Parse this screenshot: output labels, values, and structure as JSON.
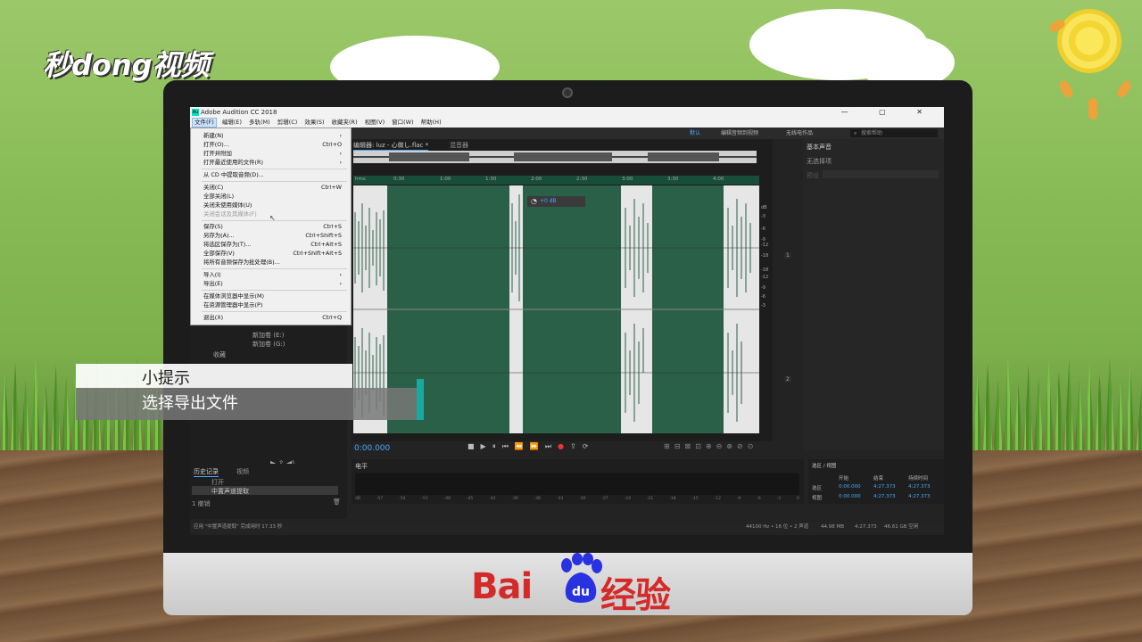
{
  "watermark_top": "秒dong视频",
  "app": {
    "title": "Adobe Audition CC 2018",
    "menu": [
      "文件(F)",
      "编辑(E)",
      "多轨(M)",
      "剪辑(C)",
      "效果(S)",
      "收藏夹(R)",
      "视图(V)",
      "窗口(W)",
      "帮助(H)"
    ],
    "workspace": {
      "default": "默认",
      "edit_video": "编辑音频到视频",
      "wireless": "无线电作品",
      "search_placeholder": "搜索帮助"
    },
    "file_menu": [
      {
        "label": "新建(N)",
        "shortcut": "",
        "sub": true
      },
      {
        "label": "打开(O)...",
        "shortcut": "Ctrl+O"
      },
      {
        "label": "打开并附加",
        "shortcut": "",
        "sub": true
      },
      {
        "label": "打开最近使用的文件(R)",
        "shortcut": "",
        "sub": true
      },
      {
        "label": "从 CD 中提取音频(D)...",
        "shortcut": ""
      },
      {
        "label": "关闭(C)",
        "shortcut": "Ctrl+W"
      },
      {
        "label": "全部关闭(L)",
        "shortcut": ""
      },
      {
        "label": "关闭未使用媒体(U)",
        "shortcut": ""
      },
      {
        "label": "关闭会话及其媒体(F)",
        "shortcut": "",
        "disabled": true
      },
      {
        "label": "保存(S)",
        "shortcut": "Ctrl+S"
      },
      {
        "label": "另存为(A)...",
        "shortcut": "Ctrl+Shift+S"
      },
      {
        "label": "将选区保存为(T)...",
        "shortcut": "Ctrl+Alt+S"
      },
      {
        "label": "全部保存(V)",
        "shortcut": "Ctrl+Shift+Alt+S"
      },
      {
        "label": "将所有音频保存为批处理(B)...",
        "shortcut": ""
      },
      {
        "label": "导入(I)",
        "shortcut": "",
        "sub": true
      },
      {
        "label": "导出(E)",
        "shortcut": "",
        "sub": true
      },
      {
        "label": "在媒体浏览器中显示(M)",
        "shortcut": ""
      },
      {
        "label": "在资源管理器中显示(P)",
        "shortcut": ""
      },
      {
        "label": "退出(X)",
        "shortcut": "Ctrl+Q"
      }
    ],
    "editor_tab": "编辑器: luz - 心做し.flac *",
    "mixer_tab": "混音器",
    "ruler_ticks": [
      "hms",
      "0:30",
      "1:00",
      "1:30",
      "2:00",
      "2:30",
      "3:00",
      "3:30",
      "4:00"
    ],
    "db_labels": [
      "dB",
      "-3",
      "-6",
      "-9",
      "-12",
      "-18",
      "-18",
      "-12",
      "-9",
      "-6",
      "-3"
    ],
    "channel_labels": [
      "1",
      "2"
    ],
    "timecode": "0:00.000",
    "volume_overlay": "+0 dB",
    "essential_sound": {
      "title": "基本声音",
      "no_selection": "无选择项",
      "preset": "预设"
    },
    "levels_title": "电平",
    "level_ticks": [
      "dB",
      "-57",
      "-54",
      "-51",
      "-48",
      "-45",
      "-42",
      "-39",
      "-36",
      "-33",
      "-30",
      "-27",
      "-24",
      "-21",
      "-18",
      "-15",
      "-12",
      "-9",
      "-6",
      "-3",
      "0"
    ],
    "selection_view": {
      "title": "选区 / 视图",
      "headers": [
        "开始",
        "结束",
        "持续时间"
      ],
      "rows": [
        {
          "label": "选区",
          "start": "0:00.000",
          "end": "4:27.373",
          "dur": "4:27.373"
        },
        {
          "label": "视图",
          "start": "0:00.000",
          "end": "4:27.373",
          "dur": "4:27.373"
        }
      ]
    },
    "files_panel": {
      "items": [
        "新加卷 (E:)",
        "新加卷 (G:)"
      ],
      "favorites": "收藏"
    },
    "history": {
      "tab1": "历史记录",
      "tab2": "视频",
      "open": "打开",
      "item": "中置声道提取",
      "count": "1 撤销"
    },
    "status": {
      "left": "应用 \"中置声道提取\" 完成用时 17.33 秒",
      "sample": "44100 Hz • 16 位 • 2 声道",
      "size": "44.98 MB",
      "duration": "4:27.373",
      "free": "46.61 GB 空闲"
    }
  },
  "tip": {
    "heading": "小提示",
    "text": "选择导出文件"
  },
  "brand_bottom": {
    "left": "Bai",
    "mid": "du",
    "right": "经验"
  },
  "colors": {
    "accent_teal": "#1aa9a0",
    "wave_green": "#2a5f48",
    "baidu_red": "#d42a2a",
    "baidu_blue": "#2932e1",
    "timecode_blue": "#4aa8ff"
  }
}
